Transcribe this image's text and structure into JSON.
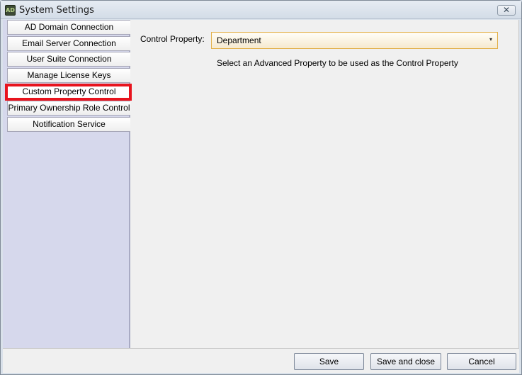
{
  "window": {
    "title": "System Settings",
    "icon_text": "AD",
    "close_glyph": "✕"
  },
  "sidebar": {
    "items": [
      {
        "label": "AD Domain Connection"
      },
      {
        "label": "Email Server Connection"
      },
      {
        "label": "User Suite Connection"
      },
      {
        "label": "Manage License Keys"
      },
      {
        "label": "Custom Property Control"
      },
      {
        "label": "Primary Ownership Role Control"
      },
      {
        "label": "Notification Service"
      }
    ],
    "selected_index": 4
  },
  "content": {
    "control_property_label": "Control Property:",
    "control_property_value": "Department",
    "dropdown_arrow": "▾",
    "help_text": "Select an Advanced Property to be used as the Control Property"
  },
  "footer": {
    "save_label": "Save",
    "save_close_label": "Save and close",
    "cancel_label": "Cancel"
  },
  "colors": {
    "highlight": "#e8141e",
    "sidebar_bg": "#d6d8ec",
    "combo_border": "#e2b04a"
  }
}
